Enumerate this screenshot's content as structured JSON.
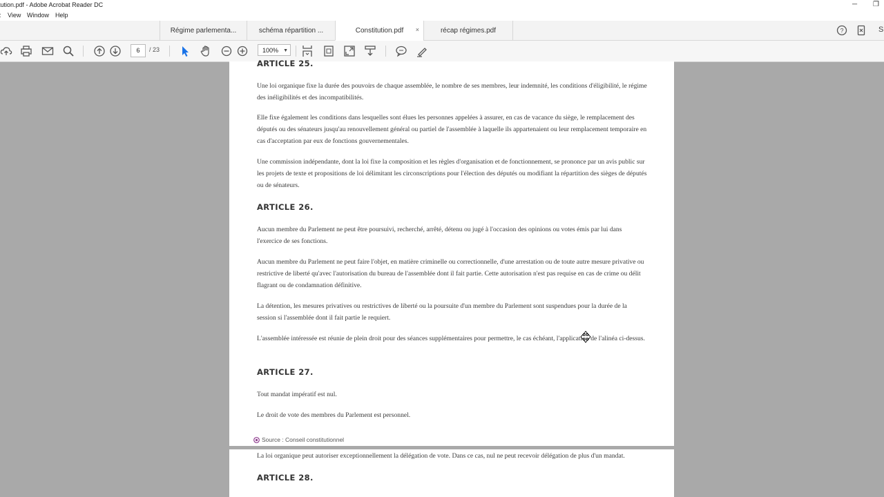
{
  "window": {
    "title": "tution.pdf - Adobe Acrobat Reader DC",
    "minimize": "─",
    "restore": "❐"
  },
  "menu": {
    "items": [
      "View",
      "Window",
      "Help"
    ],
    "partial": ":"
  },
  "tabs": [
    {
      "label": "Régime parlementa..."
    },
    {
      "label": "schéma répartition ..."
    },
    {
      "label": "Constitution.pdf",
      "close": "×"
    },
    {
      "label": "récap régimes.pdf"
    }
  ],
  "right_partial": "S",
  "toolbar": {
    "page_current": "6",
    "page_total": "/ 23",
    "zoom": "100%",
    "zoom_dd": "▼"
  },
  "document": {
    "page1": [
      {
        "type": "heading",
        "text": "ARTICLE 25."
      },
      {
        "type": "para",
        "text": "Une loi organique fixe la durée des pouvoirs de chaque assemblée, le nombre de ses membres, leur indemnité, les conditions d'éligibilité, le régime des inéligibilités et des incompatibilités."
      },
      {
        "type": "para",
        "text": "Elle fixe également les conditions dans lesquelles sont élues les personnes appelées à assurer, en cas de vacance du siège, le remplacement des députés ou des sénateurs jusqu'au renouvellement général ou partiel de l'assemblée à laquelle ils appartenaient ou leur remplacement temporaire en cas d'acceptation par eux de fonctions gouvernementales."
      },
      {
        "type": "para",
        "text": "Une commission indépendante, dont la loi fixe la composition et les règles d'organisation et de fonctionnement, se prononce par un avis public sur les projets de texte et propositions de loi délimitant les circonscriptions pour l'élection des députés ou modifiant la répartition des sièges de députés ou de sénateurs."
      },
      {
        "type": "heading",
        "text": "ARTICLE 26."
      },
      {
        "type": "para",
        "text": "Aucun membre du Parlement ne peut être poursuivi, recherché, arrêté, détenu ou jugé à l'occasion des opinions ou votes émis par lui dans l'exercice de ses fonctions."
      },
      {
        "type": "para",
        "text": "Aucun membre du Parlement ne peut faire l'objet, en matière criminelle ou correctionnelle, d'une arrestation ou de toute autre mesure privative ou restrictive de liberté qu'avec l'autorisation du bureau de l'assemblée dont il fait partie. Cette autorisation n'est pas requise en cas de crime ou délit flagrant ou de condamnation définitive."
      },
      {
        "type": "para",
        "text": "La détention, les mesures privatives ou restrictives de liberté ou la poursuite d'un membre du Parlement sont suspendues pour la durée de la session si l'assemblée dont il fait partie le requiert."
      },
      {
        "type": "para",
        "text": "L'assemblée intéressée est réunie de plein droit pour des séances supplémentaires pour permettre, le cas échéant, l'application de l'alinéa ci-dessus."
      },
      {
        "type": "heading",
        "text": "ARTICLE 27."
      },
      {
        "type": "para",
        "text": "Tout mandat impératif est nul."
      },
      {
        "type": "para",
        "text": "Le droit de vote des membres du Parlement est personnel."
      }
    ],
    "source": "Source : Conseil constitutionnel",
    "page2": [
      {
        "type": "para",
        "text": "La loi organique peut autoriser exceptionnellement la délégation de vote. Dans ce cas, nul ne peut recevoir délégation de plus d'un mandat."
      },
      {
        "type": "heading",
        "text": "ARTICLE 28."
      }
    ]
  },
  "colors": {
    "background": "#a9a9a9",
    "accent_select": "#1a73e8",
    "source_icon": "#8e3b8e"
  }
}
